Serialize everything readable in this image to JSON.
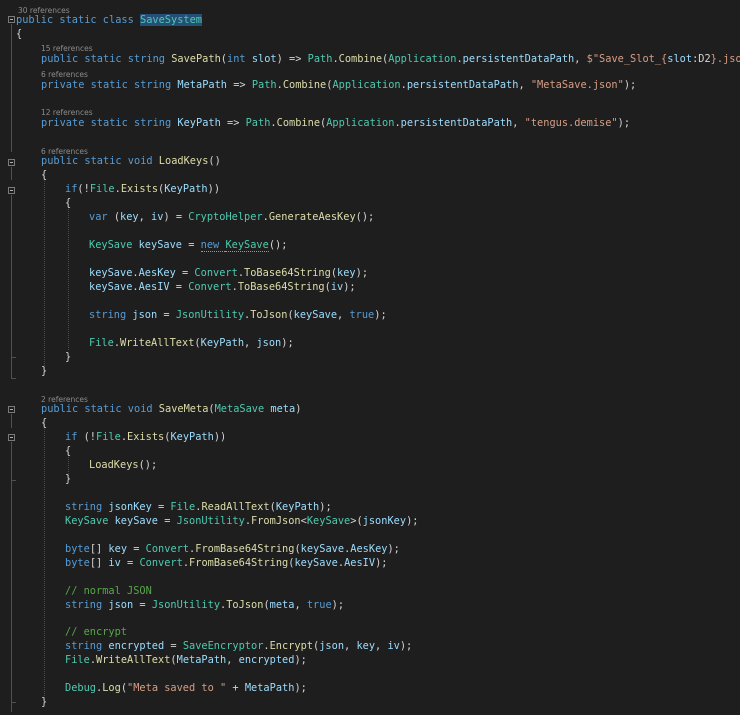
{
  "editor": {
    "codelens": {
      "class_refs": "30 references",
      "savepath_refs": "15 references",
      "metapath_refs": "6 references",
      "keypath_refs": "12 references",
      "loadkeys_refs": "6 references",
      "savemeta_refs": "2 references"
    },
    "lines": [
      [
        [
          "kw",
          "public static class "
        ],
        [
          "ty",
          "SaveSystem"
        ]
      ],
      [
        [
          "pl",
          "{"
        ]
      ],
      [
        [
          "kw",
          "public static string "
        ],
        [
          "fn",
          "SavePath"
        ],
        [
          "pl",
          "("
        ],
        [
          "kw",
          "int "
        ],
        [
          "id",
          "slot"
        ],
        [
          "pl",
          ") => "
        ],
        [
          "ty",
          "Path"
        ],
        [
          "pl",
          "."
        ],
        [
          "fn",
          "Combine"
        ],
        [
          "pl",
          "("
        ],
        [
          "ty",
          "Application"
        ],
        [
          "pl",
          "."
        ],
        [
          "id",
          "persistentDataPath"
        ],
        [
          "pl",
          ", "
        ],
        [
          "st",
          "$\"Save_Slot_{"
        ],
        [
          "id",
          "slot"
        ],
        [
          "pl",
          ":D2"
        ],
        [
          "st",
          "}.json\""
        ],
        [
          "pl",
          ");"
        ]
      ],
      [
        [
          "kw",
          "private static string "
        ],
        [
          "id",
          "MetaPath"
        ],
        [
          "pl",
          " => "
        ],
        [
          "ty",
          "Path"
        ],
        [
          "pl",
          "."
        ],
        [
          "fn",
          "Combine"
        ],
        [
          "pl",
          "("
        ],
        [
          "ty",
          "Application"
        ],
        [
          "pl",
          "."
        ],
        [
          "id",
          "persistentDataPath"
        ],
        [
          "pl",
          ", "
        ],
        [
          "st",
          "\"MetaSave.json\""
        ],
        [
          "pl",
          ");"
        ]
      ],
      [
        [
          "kw",
          "private static string "
        ],
        [
          "id",
          "KeyPath"
        ],
        [
          "pl",
          " => "
        ],
        [
          "ty",
          "Path"
        ],
        [
          "pl",
          "."
        ],
        [
          "fn",
          "Combine"
        ],
        [
          "pl",
          "("
        ],
        [
          "ty",
          "Application"
        ],
        [
          "pl",
          "."
        ],
        [
          "id",
          "persistentDataPath"
        ],
        [
          "pl",
          ", "
        ],
        [
          "st",
          "\"tengus.demise\""
        ],
        [
          "pl",
          ");"
        ]
      ],
      [
        [
          "kw",
          "public static void "
        ],
        [
          "fn",
          "LoadKeys"
        ],
        [
          "pl",
          "()"
        ]
      ],
      [
        [
          "pl",
          "{"
        ]
      ],
      [
        [
          "kw",
          "if"
        ],
        [
          "pl",
          "(!"
        ],
        [
          "ty",
          "File"
        ],
        [
          "pl",
          "."
        ],
        [
          "fn",
          "Exists"
        ],
        [
          "pl",
          "("
        ],
        [
          "id",
          "KeyPath"
        ],
        [
          "pl",
          "))"
        ]
      ],
      [
        [
          "pl",
          "{"
        ]
      ],
      [
        [
          "kw",
          "var "
        ],
        [
          "pl",
          "("
        ],
        [
          "id",
          "key"
        ],
        [
          "pl",
          ", "
        ],
        [
          "id",
          "iv"
        ],
        [
          "pl",
          ") = "
        ],
        [
          "ty",
          "CryptoHelper"
        ],
        [
          "pl",
          "."
        ],
        [
          "fn",
          "GenerateAesKey"
        ],
        [
          "pl",
          "();"
        ]
      ],
      [
        [
          "ty",
          "KeySave "
        ],
        [
          "id",
          "keySave"
        ],
        [
          "pl",
          " = "
        ],
        [
          "kw",
          "new "
        ],
        [
          "ty",
          "KeySave"
        ],
        [
          "pl",
          "();"
        ]
      ],
      [
        [
          "id",
          "keySave"
        ],
        [
          "pl",
          "."
        ],
        [
          "id",
          "AesKey"
        ],
        [
          "pl",
          " = "
        ],
        [
          "ty",
          "Convert"
        ],
        [
          "pl",
          "."
        ],
        [
          "fn",
          "ToBase64String"
        ],
        [
          "pl",
          "("
        ],
        [
          "id",
          "key"
        ],
        [
          "pl",
          ");"
        ]
      ],
      [
        [
          "id",
          "keySave"
        ],
        [
          "pl",
          "."
        ],
        [
          "id",
          "AesIV"
        ],
        [
          "pl",
          " = "
        ],
        [
          "ty",
          "Convert"
        ],
        [
          "pl",
          "."
        ],
        [
          "fn",
          "ToBase64String"
        ],
        [
          "pl",
          "("
        ],
        [
          "id",
          "iv"
        ],
        [
          "pl",
          ");"
        ]
      ],
      [
        [
          "kw",
          "string "
        ],
        [
          "id",
          "json"
        ],
        [
          "pl",
          " = "
        ],
        [
          "ty",
          "JsonUtility"
        ],
        [
          "pl",
          "."
        ],
        [
          "fn",
          "ToJson"
        ],
        [
          "pl",
          "("
        ],
        [
          "id",
          "keySave"
        ],
        [
          "pl",
          ", "
        ],
        [
          "kw",
          "true"
        ],
        [
          "pl",
          ");"
        ]
      ],
      [
        [
          "ty",
          "File"
        ],
        [
          "pl",
          "."
        ],
        [
          "fn",
          "WriteAllText"
        ],
        [
          "pl",
          "("
        ],
        [
          "id",
          "KeyPath"
        ],
        [
          "pl",
          ", "
        ],
        [
          "id",
          "json"
        ],
        [
          "pl",
          ");"
        ]
      ],
      [
        [
          "pl",
          "}"
        ]
      ],
      [
        [
          "pl",
          "}"
        ]
      ],
      [
        [
          "kw",
          "public static void "
        ],
        [
          "fn",
          "SaveMeta"
        ],
        [
          "pl",
          "("
        ],
        [
          "ty",
          "MetaSave "
        ],
        [
          "id",
          "meta"
        ],
        [
          "pl",
          ")"
        ]
      ],
      [
        [
          "pl",
          "{"
        ]
      ],
      [
        [
          "kw",
          "if "
        ],
        [
          "pl",
          "(!"
        ],
        [
          "ty",
          "File"
        ],
        [
          "pl",
          "."
        ],
        [
          "fn",
          "Exists"
        ],
        [
          "pl",
          "("
        ],
        [
          "id",
          "KeyPath"
        ],
        [
          "pl",
          "))"
        ]
      ],
      [
        [
          "pl",
          "{"
        ]
      ],
      [
        [
          "fn",
          "LoadKeys"
        ],
        [
          "pl",
          "();"
        ]
      ],
      [
        [
          "pl",
          "}"
        ]
      ],
      [
        [
          "kw",
          "string "
        ],
        [
          "id",
          "jsonKey"
        ],
        [
          "pl",
          " = "
        ],
        [
          "ty",
          "File"
        ],
        [
          "pl",
          "."
        ],
        [
          "fn",
          "ReadAllText"
        ],
        [
          "pl",
          "("
        ],
        [
          "id",
          "KeyPath"
        ],
        [
          "pl",
          ");"
        ]
      ],
      [
        [
          "ty",
          "KeySave "
        ],
        [
          "id",
          "keySave"
        ],
        [
          "pl",
          " = "
        ],
        [
          "ty",
          "JsonUtility"
        ],
        [
          "pl",
          "."
        ],
        [
          "fn",
          "FromJson"
        ],
        [
          "pl",
          "<"
        ],
        [
          "ty",
          "KeySave"
        ],
        [
          "pl",
          ">("
        ],
        [
          "id",
          "jsonKey"
        ],
        [
          "pl",
          ");"
        ]
      ],
      [
        [
          "kw",
          "byte"
        ],
        [
          "pl",
          "[] "
        ],
        [
          "id",
          "key"
        ],
        [
          "pl",
          " = "
        ],
        [
          "ty",
          "Convert"
        ],
        [
          "pl",
          "."
        ],
        [
          "fn",
          "FromBase64String"
        ],
        [
          "pl",
          "("
        ],
        [
          "id",
          "keySave"
        ],
        [
          "pl",
          "."
        ],
        [
          "id",
          "AesKey"
        ],
        [
          "pl",
          ");"
        ]
      ],
      [
        [
          "kw",
          "byte"
        ],
        [
          "pl",
          "[] "
        ],
        [
          "id",
          "iv"
        ],
        [
          "pl",
          " = "
        ],
        [
          "ty",
          "Convert"
        ],
        [
          "pl",
          "."
        ],
        [
          "fn",
          "FromBase64String"
        ],
        [
          "pl",
          "("
        ],
        [
          "id",
          "keySave"
        ],
        [
          "pl",
          "."
        ],
        [
          "id",
          "AesIV"
        ],
        [
          "pl",
          ");"
        ]
      ],
      [
        [
          "cm",
          "// normal JSON"
        ]
      ],
      [
        [
          "kw",
          "string "
        ],
        [
          "id",
          "json"
        ],
        [
          "pl",
          " = "
        ],
        [
          "ty",
          "JsonUtility"
        ],
        [
          "pl",
          "."
        ],
        [
          "fn",
          "ToJson"
        ],
        [
          "pl",
          "("
        ],
        [
          "id",
          "meta"
        ],
        [
          "pl",
          ", "
        ],
        [
          "kw",
          "true"
        ],
        [
          "pl",
          ");"
        ]
      ],
      [
        [
          "cm",
          "// encrypt"
        ]
      ],
      [
        [
          "kw",
          "string "
        ],
        [
          "id",
          "encrypted"
        ],
        [
          "pl",
          " = "
        ],
        [
          "ty",
          "SaveEncryptor"
        ],
        [
          "pl",
          "."
        ],
        [
          "fn",
          "Encrypt"
        ],
        [
          "pl",
          "("
        ],
        [
          "id",
          "json"
        ],
        [
          "pl",
          ", "
        ],
        [
          "id",
          "key"
        ],
        [
          "pl",
          ", "
        ],
        [
          "id",
          "iv"
        ],
        [
          "pl",
          ");"
        ]
      ],
      [
        [
          "ty",
          "File"
        ],
        [
          "pl",
          "."
        ],
        [
          "fn",
          "WriteAllText"
        ],
        [
          "pl",
          "("
        ],
        [
          "id",
          "MetaPath"
        ],
        [
          "pl",
          ", "
        ],
        [
          "id",
          "encrypted"
        ],
        [
          "pl",
          ");"
        ]
      ],
      [
        [
          "ty",
          "Debug"
        ],
        [
          "pl",
          "."
        ],
        [
          "fn",
          "Log"
        ],
        [
          "pl",
          "("
        ],
        [
          "st",
          "\"Meta saved to \""
        ],
        [
          "pl",
          " + "
        ],
        [
          "id",
          "MetaPath"
        ],
        [
          "pl",
          ");"
        ]
      ],
      [
        [
          "pl",
          "}"
        ]
      ]
    ]
  }
}
